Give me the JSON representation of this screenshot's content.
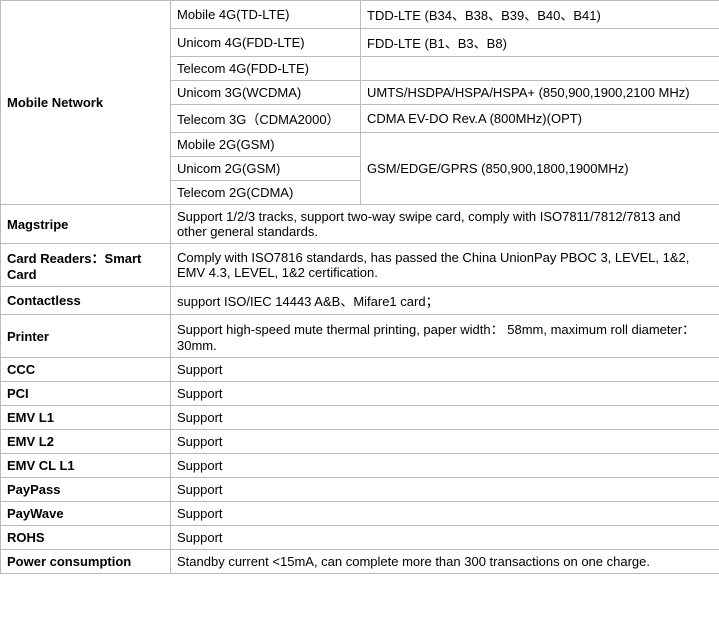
{
  "mobile_network": {
    "label": "Mobile Network",
    "rows": [
      {
        "op": "Mobile 4G(TD-LTE)",
        "spec": "TDD-LTE (B34、B38、B39、B40、B41)"
      },
      {
        "op": "Unicom 4G(FDD-LTE)",
        "spec": "FDD-LTE (B1、B3、B8)"
      },
      {
        "op": "Telecom 4G(FDD-LTE)",
        "spec": ""
      },
      {
        "op": "Unicom 3G(WCDMA)",
        "spec": "UMTS/HSDPA/HSPA/HSPA+ (850,900,1900,2100 MHz)"
      },
      {
        "op": "Telecom 3G（CDMA2000）",
        "spec": "CDMA EV-DO Rev.A (800MHz)(OPT)"
      },
      {
        "op": "Mobile 2G(GSM)",
        "spec": "GSM/EDGE/GPRS (850,900,1800,1900MHz)"
      },
      {
        "op": "Unicom 2G(GSM)",
        "spec": ""
      },
      {
        "op": "Telecom 2G(CDMA)",
        "spec": ""
      }
    ]
  },
  "magstripe": {
    "label": "Magstripe",
    "value": "Support 1/2/3 tracks, support two-way swipe card, comply with ISO7811/7812/7813 and other general standards."
  },
  "smart_card": {
    "label": "Card Readers：Smart Card",
    "value": "Comply with ISO7816 standards, has passed the China UnionPay PBOC 3, LEVEL, 1&2, EMV 4.3, LEVEL, 1&2 certification."
  },
  "contactless": {
    "label": "Contactless",
    "value": "support ISO/IEC 14443 A&B、Mifare1 card；"
  },
  "printer": {
    "label": "Printer",
    "value": "Support high-speed mute thermal printing, paper width： 58mm, maximum roll diameter：30mm."
  },
  "ccc": {
    "label": "CCC",
    "value": "Support"
  },
  "pci": {
    "label": "PCI",
    "value": "Support"
  },
  "emv_l1": {
    "label": "EMV L1",
    "value": "Support"
  },
  "emv_l2": {
    "label": "EMV L2",
    "value": "Support"
  },
  "emv_cl_l1": {
    "label": "EMV CL L1",
    "value": "Support"
  },
  "paypass": {
    "label": "PayPass",
    "value": "Support"
  },
  "paywave": {
    "label": "PayWave",
    "value": "Support"
  },
  "rohs": {
    "label": "ROHS",
    "value": "Support"
  },
  "power": {
    "label": "Power consumption",
    "value": "Standby current <15mA,  can complete more than 300 transactions on one charge."
  }
}
